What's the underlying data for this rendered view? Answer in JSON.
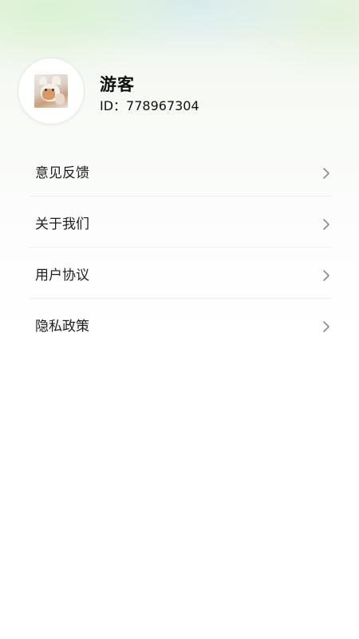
{
  "profile": {
    "name": "游客",
    "id_text": "ID：778967304"
  },
  "menu": {
    "items": [
      {
        "label": "意见反馈",
        "icon": "chevron-right-icon"
      },
      {
        "label": "关于我们",
        "icon": "chevron-right-icon"
      },
      {
        "label": "用户协议",
        "icon": "chevron-right-icon"
      },
      {
        "label": "隐私政策",
        "icon": "chevron-right-icon"
      }
    ]
  },
  "colors": {
    "text": "#1e1e1e",
    "divider": "#efefef",
    "chevron": "#8a8a8a",
    "header_wash": "#f0f6ee"
  }
}
